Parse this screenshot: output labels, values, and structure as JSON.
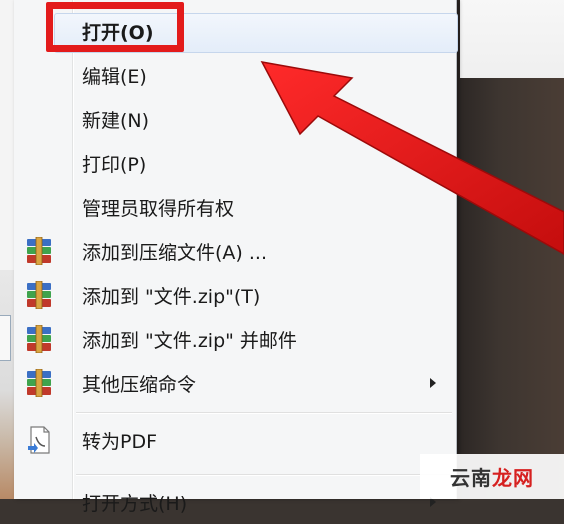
{
  "menu": {
    "items": [
      {
        "label": "打开(O)",
        "bold": true,
        "highlighted": true,
        "icon": null,
        "submenu": false
      },
      {
        "label": "编辑(E)",
        "icon": null,
        "submenu": false
      },
      {
        "label": "新建(N)",
        "icon": null,
        "submenu": false
      },
      {
        "label": "打印(P)",
        "icon": null,
        "submenu": false
      },
      {
        "label": "管理员取得所有权",
        "icon": null,
        "submenu": false
      },
      {
        "label": "添加到压缩文件(A) ...",
        "icon": "winrar-archive-icon",
        "submenu": false
      },
      {
        "label": "添加到 \"文件.zip\"(T)",
        "icon": "winrar-archive-icon",
        "submenu": false
      },
      {
        "label": "添加到 \"文件.zip\" 并邮件",
        "icon": "winrar-archive-icon",
        "submenu": false
      },
      {
        "label": "其他压缩命令",
        "icon": "winrar-archive-icon",
        "submenu": true
      },
      {
        "label": "转为PDF",
        "icon": "pdf-convert-icon",
        "submenu": false
      },
      {
        "label": "打开方式(H)",
        "icon": null,
        "submenu": true
      }
    ]
  },
  "watermark": {
    "part1": "云南",
    "part2": "龙网"
  },
  "colors": {
    "annotation_red": "#e31b1b",
    "menu_bg": "#f5f6f7",
    "highlight_bg": "#e4edf9"
  }
}
